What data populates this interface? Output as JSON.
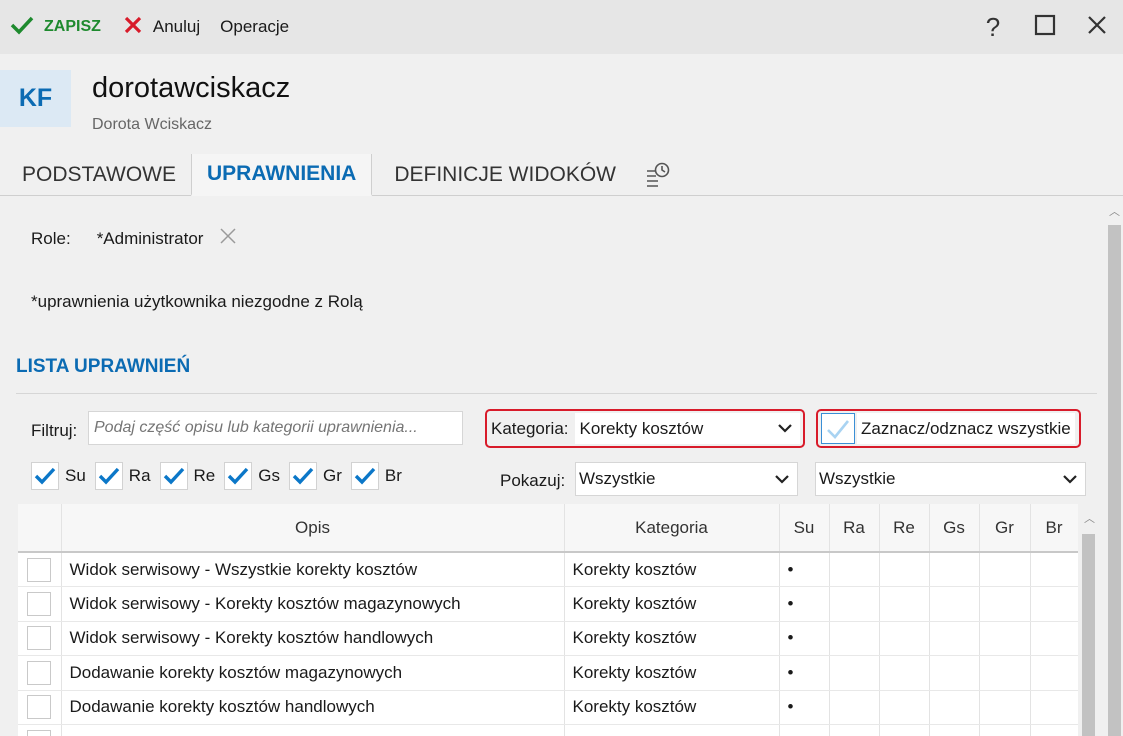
{
  "toolbar": {
    "save_label": "ZAPISZ",
    "cancel_label": "Anuluj",
    "operations_label": "Operacje"
  },
  "window": {
    "help": "?"
  },
  "header": {
    "avatar_initials": "KF",
    "username": "dorotawciskacz",
    "fullname": "Dorota Wciskacz"
  },
  "tabs": [
    {
      "label": "PODSTAWOWE",
      "active": false
    },
    {
      "label": "UPRAWNIENIA",
      "active": true
    },
    {
      "label": "DEFINICJE WIDOKÓW",
      "active": false
    }
  ],
  "roles": {
    "label": "Role:",
    "value": "*Administrator"
  },
  "note": "*uprawnienia użytkownika niezgodne z Rolą",
  "section_title": "LISTA UPRAWNIEŃ",
  "filter": {
    "label": "Filtruj:",
    "placeholder": "Podaj część opisu lub kategorii uprawnienia..."
  },
  "category": {
    "label": "Kategoria:",
    "value": "Korekty kosztów"
  },
  "toggle_all": {
    "label": "Zaznacz/odznacz wszystkie"
  },
  "flags": [
    {
      "label": "Su",
      "checked": true
    },
    {
      "label": "Ra",
      "checked": true
    },
    {
      "label": "Re",
      "checked": true
    },
    {
      "label": "Gs",
      "checked": true
    },
    {
      "label": "Gr",
      "checked": true
    },
    {
      "label": "Br",
      "checked": true
    }
  ],
  "show": {
    "label": "Pokazuj:",
    "value1": "Wszystkie",
    "value2": "Wszystkie"
  },
  "table": {
    "columns": [
      "Opis",
      "Kategoria",
      "Su",
      "Ra",
      "Re",
      "Gs",
      "Gr",
      "Br"
    ],
    "rows": [
      {
        "opis": "Widok serwisowy - Wszystkie korekty kosztów",
        "kategoria": "Korekty kosztów",
        "su": "•"
      },
      {
        "opis": "Widok serwisowy - Korekty kosztów magazynowych",
        "kategoria": "Korekty kosztów",
        "su": "•"
      },
      {
        "opis": "Widok serwisowy - Korekty kosztów handlowych",
        "kategoria": "Korekty kosztów",
        "su": "•"
      },
      {
        "opis": "Dodawanie korekty kosztów magazynowych",
        "kategoria": "Korekty kosztów",
        "su": "•"
      },
      {
        "opis": "Dodawanie korekty kosztów handlowych",
        "kategoria": "Korekty kosztów",
        "su": "•"
      },
      {
        "opis": "",
        "kategoria": "",
        "su": ""
      }
    ]
  },
  "colors": {
    "accent": "#0b6bb3",
    "save_green": "#1e8a2e",
    "cancel_red": "#d81b2a",
    "highlight_border": "#d81b2a"
  }
}
